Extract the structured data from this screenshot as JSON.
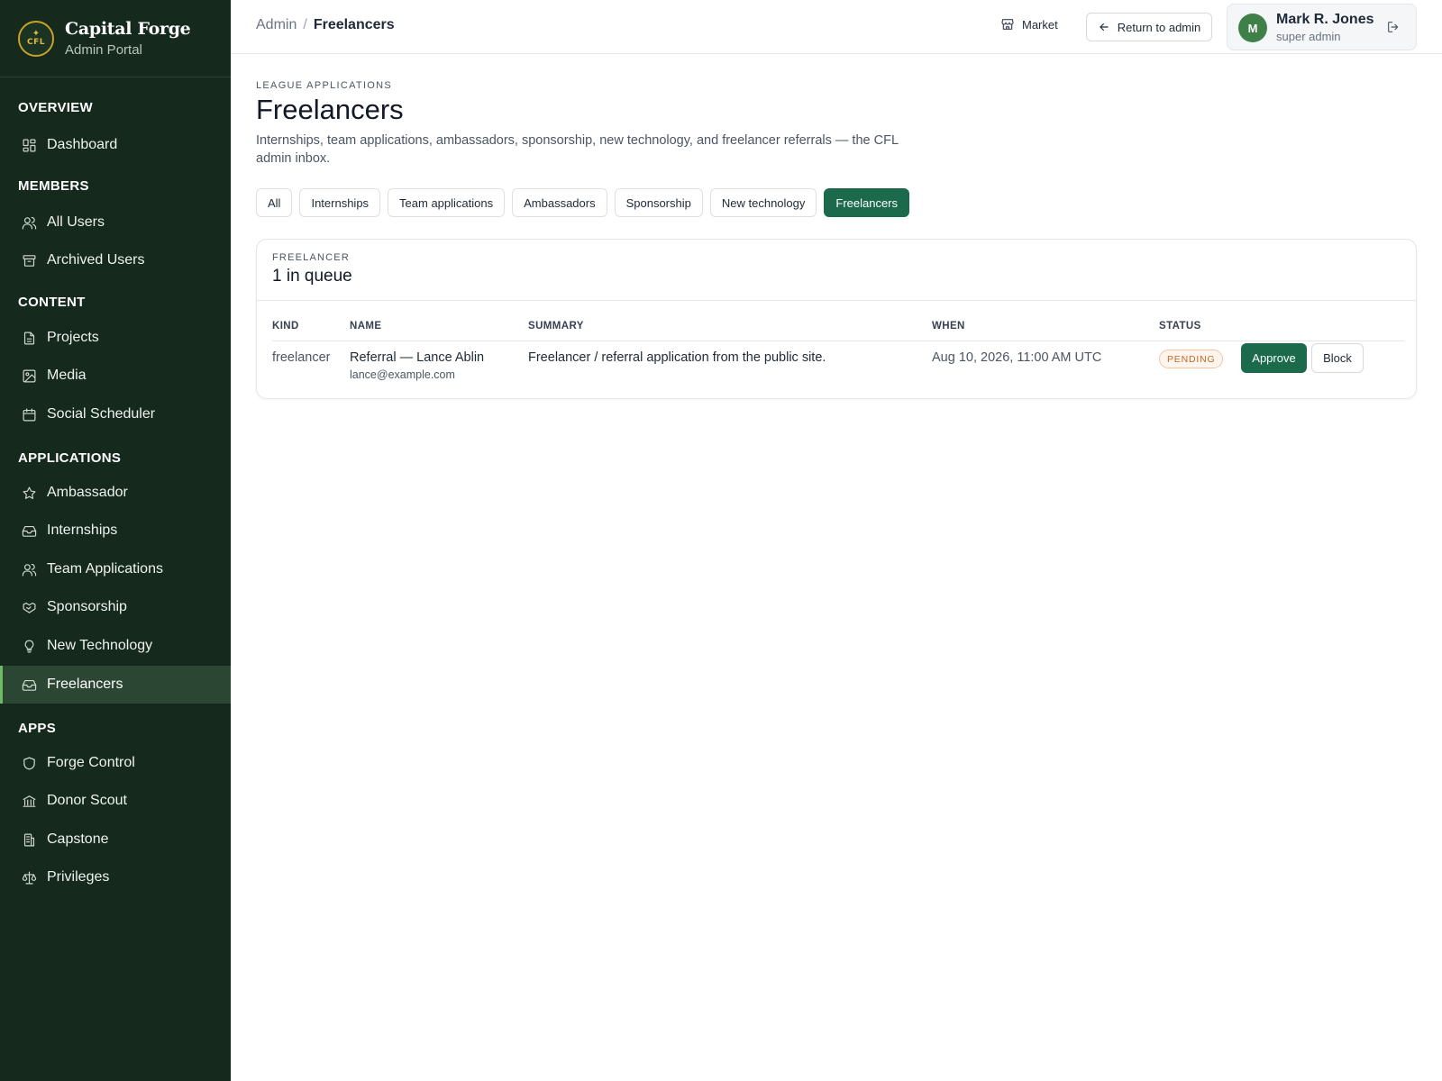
{
  "brand": {
    "title": "Capital Forge",
    "subtitle": "Admin Portal",
    "logo_text": "CFL"
  },
  "sidebar": {
    "sections": [
      {
        "label": "OVERVIEW"
      },
      {
        "label": "MEMBERS"
      },
      {
        "label": "CONTENT"
      },
      {
        "label": "APPLICATIONS"
      },
      {
        "label": "APPS"
      }
    ],
    "items": [
      {
        "label": "Dashboard",
        "icon": "dashboard-icon"
      },
      {
        "label": "All Users",
        "icon": "users-icon"
      },
      {
        "label": "Archived Users",
        "icon": "archive-icon"
      },
      {
        "label": "Projects",
        "icon": "file-icon"
      },
      {
        "label": "Media",
        "icon": "image-icon"
      },
      {
        "label": "Social Scheduler",
        "icon": "calendar-icon"
      },
      {
        "label": "Ambassador",
        "icon": "star-icon"
      },
      {
        "label": "Internships",
        "icon": "inbox-icon"
      },
      {
        "label": "Team Applications",
        "icon": "users-icon"
      },
      {
        "label": "Sponsorship",
        "icon": "handshake-icon"
      },
      {
        "label": "New Technology",
        "icon": "lightbulb-icon"
      },
      {
        "label": "Freelancers",
        "icon": "inbox-icon",
        "active": true
      },
      {
        "label": "Forge Control",
        "icon": "shield-icon"
      },
      {
        "label": "Donor Scout",
        "icon": "bank-icon"
      },
      {
        "label": "Capstone",
        "icon": "building-icon"
      },
      {
        "label": "Privileges",
        "icon": "scale-icon"
      }
    ]
  },
  "topbar": {
    "breadcrumb": {
      "root": "Admin",
      "separator": "/",
      "current": "Freelancers"
    },
    "market_label": "Market",
    "return_label": "Return to admin",
    "user": {
      "initial": "M",
      "name": "Mark R. Jones",
      "role": "super admin"
    }
  },
  "page": {
    "eyebrow": "LEAGUE APPLICATIONS",
    "title": "Freelancers",
    "description": "Internships, team applications, ambassadors, sponsorship, new technology, and freelancer referrals — the CFL admin inbox."
  },
  "filters": [
    {
      "label": "All"
    },
    {
      "label": "Internships"
    },
    {
      "label": "Team applications"
    },
    {
      "label": "Ambassadors"
    },
    {
      "label": "Sponsorship"
    },
    {
      "label": "New technology"
    },
    {
      "label": "Freelancers",
      "active": true
    }
  ],
  "queue": {
    "eyebrow": "FREELANCER",
    "title": "1 in queue",
    "columns": {
      "kind": "KIND",
      "name": "NAME",
      "summary": "SUMMARY",
      "when": "WHEN",
      "status": "STATUS"
    },
    "rows": [
      {
        "kind": "freelancer",
        "name": "Referral — Lance Ablin",
        "email": "lance@example.com",
        "summary": "Freelancer / referral application from the public site.",
        "when": "Aug 10, 2026, 11:00 AM UTC",
        "status": "PENDING",
        "approve_label": "Approve",
        "block_label": "Block"
      }
    ]
  },
  "colors": {
    "sidebar_bg": "#15291d",
    "accent_green": "#1b6a4c",
    "active_indicator": "#6dbb63",
    "pending_text": "#c4671f",
    "logo_gold": "#c9a227"
  }
}
